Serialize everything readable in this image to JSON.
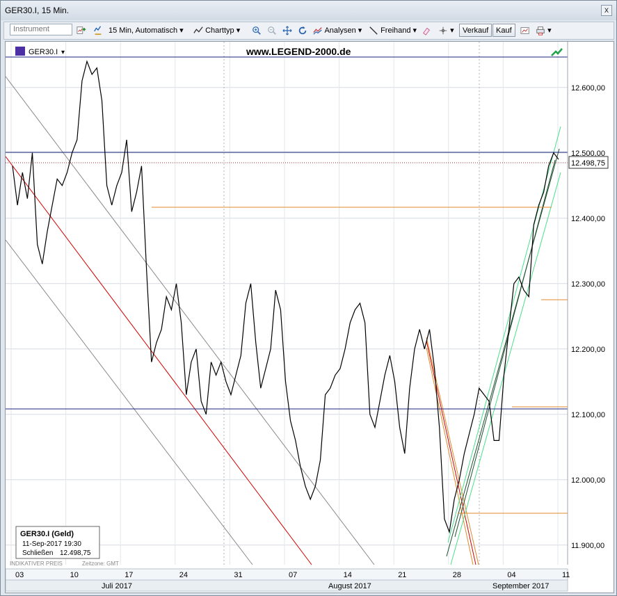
{
  "window": {
    "title": "GER30.I, 15 Min.",
    "close_glyph": "x"
  },
  "toolbar": {
    "instrument_placeholder": "Instrument",
    "interval": "15 Min,",
    "mode": "Automatisch",
    "charttype": "Charttyp",
    "analysen": "Analysen",
    "freihand": "Freihand",
    "verkauf": "Verkauf",
    "kauf": "Kauf"
  },
  "chart": {
    "symbol": "GER30.I",
    "watermark": "www.LEGEND-2000.de",
    "price_label": "12.498,75",
    "footer_left": "INDIKATIVER PREIS",
    "footer_zone": "Zeitzone: GMT",
    "info_box": {
      "title": "GER30.I (Geld)",
      "datetime": "11-Sep-2017 19:30",
      "close_label": "Schließen",
      "close_value": "12.498,75"
    },
    "colors": {
      "price_line": "#000000",
      "red_trend": "#d10000",
      "orange_level": "#e08a2c",
      "navy_level": "#1a237e",
      "green_channel": "#49e08a"
    }
  },
  "chart_data": {
    "type": "line",
    "title": "",
    "y_ticks": [
      "12.600,00",
      "12.500,00",
      "12.400,00",
      "12.300,00",
      "12.200,00",
      "12.100,00",
      "12.000,00",
      "11.900,00"
    ],
    "y_tick_values": [
      12600,
      12500,
      12400,
      12300,
      12200,
      12100,
      12000,
      11900
    ],
    "x_day_ticks": [
      "03",
      "10",
      "17",
      "24",
      "31",
      "07",
      "14",
      "21",
      "28",
      "04",
      "11"
    ],
    "x_months": [
      "Juli 2017",
      "August 2017",
      "September 2017"
    ],
    "ylim": [
      11870,
      12670
    ],
    "series": [
      {
        "values": [
          12480,
          12420,
          12470,
          12430,
          12500,
          12360,
          12330,
          12380,
          12420,
          12460,
          12450,
          12470,
          12500,
          12520,
          12610,
          12640,
          12620,
          12630,
          12580,
          12450,
          12420,
          12450,
          12470,
          12520,
          12410,
          12440,
          12480,
          12320,
          12180,
          12210,
          12230,
          12280,
          12260,
          12300,
          12240,
          12130,
          12180,
          12200,
          12120,
          12100,
          12180,
          12160,
          12180,
          12150,
          12130,
          12160,
          12190,
          12270,
          12300,
          12210,
          12140,
          12170,
          12200,
          12290,
          12260,
          12150,
          12090,
          12060,
          12020,
          11990,
          11970,
          11990,
          12030,
          12130,
          12140,
          12160,
          12170,
          12200,
          12240,
          12260,
          12270,
          12240,
          12100,
          12080,
          12120,
          12160,
          12190,
          12150,
          12080,
          12040,
          12140,
          12200,
          12230,
          12200,
          12230,
          12170,
          12080,
          11940,
          11920,
          11970,
          12000,
          12040,
          12070,
          12100,
          12140,
          12130,
          12120,
          12060,
          12060,
          12160,
          12230,
          12300,
          12310,
          12290,
          12280,
          12390,
          12420,
          12440,
          12480,
          12500,
          12490
        ]
      }
    ],
    "horizontal_levels": [
      {
        "color": "#1a237e",
        "value": 12662
      },
      {
        "color": "#1a237e",
        "value": 12515
      },
      {
        "color": "#9b2b2b",
        "value": 12498.75
      },
      {
        "color": "#e08a2c",
        "value": 12430
      },
      {
        "color": "#e08a2c",
        "value": 12283
      },
      {
        "color": "#1a237e",
        "value": 12113
      },
      {
        "color": "#e08a2c",
        "value": 12116
      },
      {
        "color": "#e08a2c",
        "value": 11948
      }
    ]
  }
}
